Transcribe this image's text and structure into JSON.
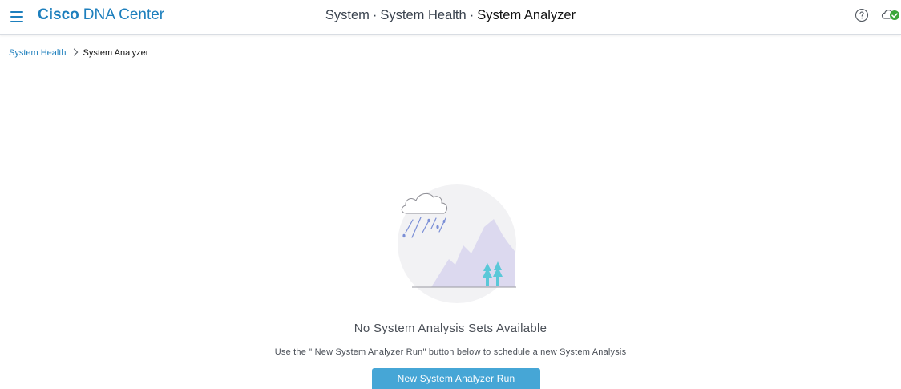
{
  "header": {
    "brand_bold": "Cisco",
    "brand_rest": "DNA Center",
    "heading_part1": "System",
    "heading_sep1": "·",
    "heading_part2": "System Health",
    "heading_sep2": "·",
    "heading_current": "System Analyzer",
    "icons": {
      "menu": "hamburger-menu-icon",
      "help": "help-icon",
      "status": "cloud-status-icon"
    },
    "accent_color": "#1d7fbd",
    "status_color": "#3aa63a"
  },
  "breadcrumb": {
    "parent": "System Health",
    "current": "System Analyzer"
  },
  "empty_state": {
    "title": "No System Analysis Sets Available",
    "description": "Use the \" New System Analyzer Run\"  button below to schedule a new System Analysis",
    "button_label": "New System Analyzer Run",
    "button_color": "#46a6d6"
  }
}
